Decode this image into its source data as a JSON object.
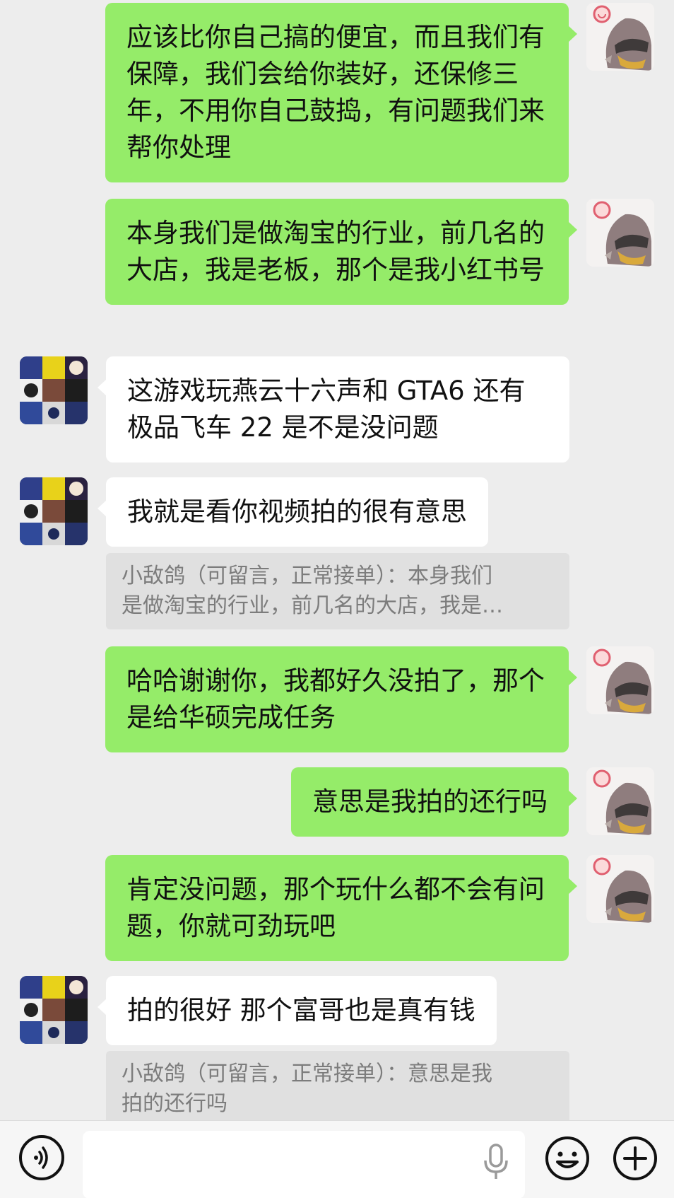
{
  "messages": [
    {
      "side": "me",
      "text": "应该比你自己搞的便宜，而且我们有保障，我们会给你装好，还保修三年，不用你自己鼓捣，有问题我们来帮你处理"
    },
    {
      "side": "me",
      "text": "本身我们是做淘宝的行业，前几名的大店，我是老板，那个是我小红书号"
    },
    {
      "side": "other",
      "text": "这游戏玩燕云十六声和 GTA6 还有极品飞车 22 是不是没问题"
    },
    {
      "side": "other",
      "text": "我就是看你视频拍的很有意思",
      "quote_line1": "小敌鸽（可留言，正常接单）：本身我们",
      "quote_line2": "是做淘宝的行业，前几名的大店，我是…"
    },
    {
      "side": "me",
      "text": "哈哈谢谢你，我都好久没拍了，那个是给华硕完成任务"
    },
    {
      "side": "me",
      "text": "意思是我拍的还行吗"
    },
    {
      "side": "me",
      "text": "肯定没问题，那个玩什么都不会有问题，你就可劲玩吧"
    },
    {
      "side": "other",
      "text": "拍的很好 那个富哥也是真有钱",
      "quote_line1": "小敌鸽（可留言，正常接单）：意思是我",
      "quote_line2": "拍的还行吗"
    }
  ],
  "colors": {
    "background": "#ededed",
    "my_bubble": "#95ec69",
    "other_bubble": "#ffffff",
    "quote_bg": "#e0e0e0"
  },
  "input_bar": {
    "voice_icon": "voice-wave-icon",
    "mic_icon": "microphone-icon",
    "emoji_icon": "smiley-icon",
    "plus_icon": "plus-circle-icon"
  }
}
